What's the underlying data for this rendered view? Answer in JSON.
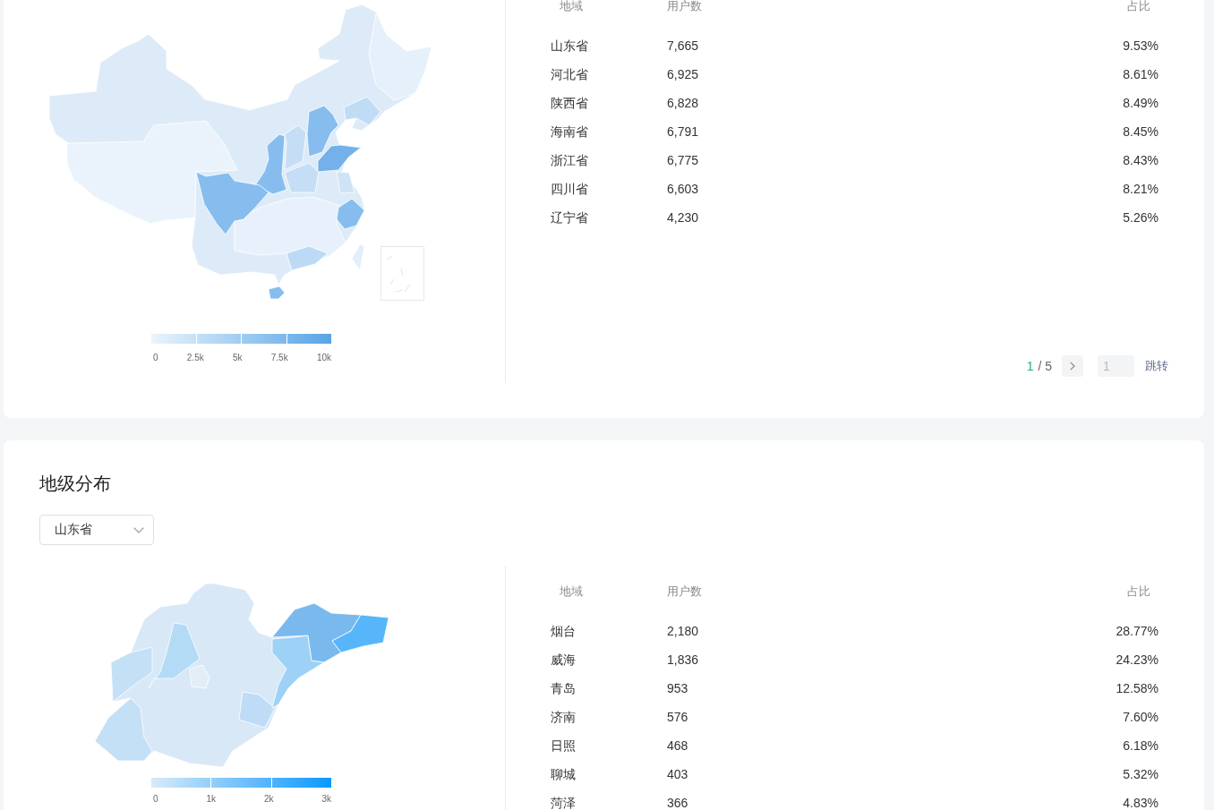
{
  "province_panel": {
    "table": {
      "columns": [
        "地域",
        "用户数",
        "占比"
      ],
      "rows": [
        {
          "region": "山东省",
          "users": "7,665",
          "share": "9.53%"
        },
        {
          "region": "河北省",
          "users": "6,925",
          "share": "8.61%"
        },
        {
          "region": "陕西省",
          "users": "6,828",
          "share": "8.49%"
        },
        {
          "region": "海南省",
          "users": "6,791",
          "share": "8.45%"
        },
        {
          "region": "浙江省",
          "users": "6,775",
          "share": "8.43%"
        },
        {
          "region": "四川省",
          "users": "6,603",
          "share": "8.21%"
        },
        {
          "region": "辽宁省",
          "users": "4,230",
          "share": "5.26%"
        }
      ]
    },
    "legend": {
      "ticks": [
        "0",
        "2.5k",
        "5k",
        "7.5k",
        "10k"
      ]
    },
    "pagination": {
      "current": "1",
      "of_total": "/ 5",
      "jump_input": {
        "placeholder": "1"
      },
      "jump_label": "跳转"
    }
  },
  "city_panel": {
    "title": "地级分布",
    "province_select": {
      "value": "山东省"
    },
    "legend": {
      "ticks": [
        "0",
        "1k",
        "2k",
        "3k"
      ]
    },
    "table": {
      "columns": [
        "地域",
        "用户数",
        "占比"
      ],
      "rows": [
        {
          "region": "烟台",
          "users": "2,180",
          "share": "28.77%"
        },
        {
          "region": "威海",
          "users": "1,836",
          "share": "24.23%"
        },
        {
          "region": "青岛",
          "users": "953",
          "share": "12.58%"
        },
        {
          "region": "济南",
          "users": "576",
          "share": "7.60%"
        },
        {
          "region": "日照",
          "users": "468",
          "share": "6.18%"
        },
        {
          "region": "聊城",
          "users": "403",
          "share": "5.32%"
        },
        {
          "region": "菏泽",
          "users": "366",
          "share": "4.83%"
        }
      ]
    }
  }
}
